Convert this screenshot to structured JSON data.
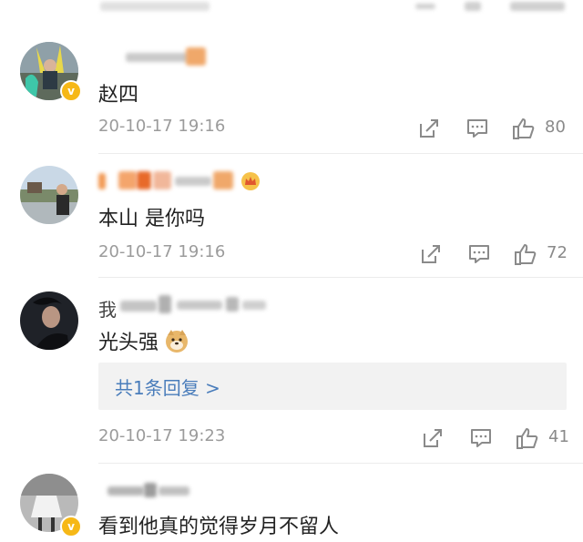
{
  "comments": [
    {
      "text": "赵四",
      "time": "20-10-17 19:16",
      "likes": "80",
      "verified": true
    },
    {
      "text": "本山 是你吗",
      "time": "20-10-17 19:16",
      "likes": "72",
      "verified": false,
      "crown": true
    },
    {
      "text": "光头强",
      "emoji": "doge-emoji",
      "time": "20-10-17 19:23",
      "likes": "41",
      "verified": false,
      "name_prefix": "我",
      "reply_link": "共1条回复 >"
    },
    {
      "text": "看到他真的觉得岁月不留人",
      "verified": true
    }
  ],
  "icons": {
    "share": "share-icon",
    "comment": "comment-icon",
    "like": "thumbs-up-icon"
  },
  "colors": {
    "time": "#9b9b9b",
    "link": "#4a7dbb",
    "badge": "#f6b817",
    "icon": "#8a8a8a"
  }
}
